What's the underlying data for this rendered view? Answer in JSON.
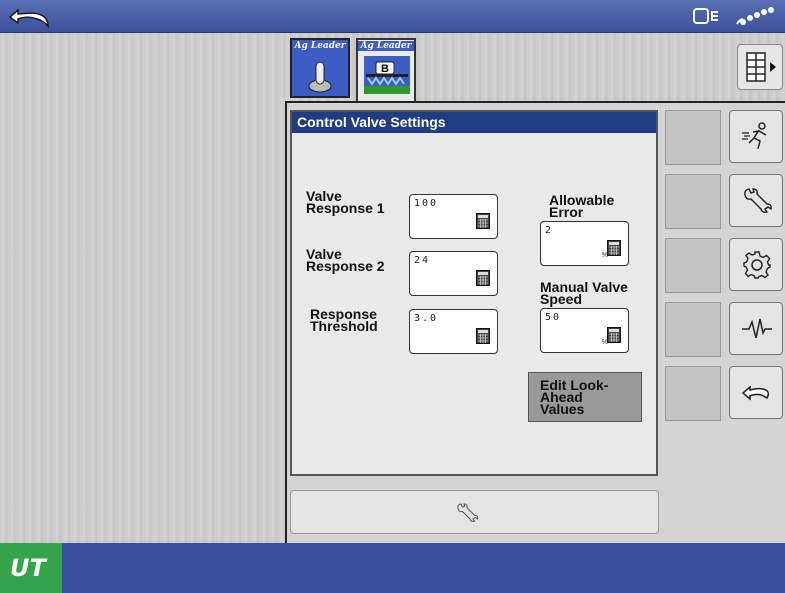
{
  "app_tabs": [
    {
      "brand": "Ag Leader",
      "icon": "joystick-icon"
    },
    {
      "brand": "Ag Leader",
      "icon": "sprayer-boom-icon",
      "badge": "B"
    }
  ],
  "dialog": {
    "title": "Control Valve Settings",
    "fields": {
      "valve_response_1": {
        "label1": "Valve",
        "label2": "Response 1",
        "value": "100"
      },
      "valve_response_2": {
        "label1": "Valve",
        "label2": "Response 2",
        "value": "24"
      },
      "response_threshold": {
        "label1": "Response",
        "label2": "Threshold",
        "value": "3.0"
      },
      "allowable_error": {
        "label1": "Allowable",
        "label2": "Error",
        "value": "2",
        "unit": "%"
      },
      "manual_valve_speed": {
        "label1": "Manual Valve",
        "label2": "Speed",
        "value": "50",
        "unit": "%"
      }
    },
    "edit_button": {
      "line1": "Edit Look-",
      "line2": "Ahead",
      "line3": "Values"
    }
  },
  "side_buttons": [
    "running-person-icon",
    "wrench-icon",
    "gear-icon",
    "waveform-icon",
    "back-arrow-icon"
  ],
  "logo": "UT",
  "colors": {
    "topbar": "#4a5fa8",
    "title_bar": "#1e3d82",
    "ut_green": "#35a34a"
  }
}
